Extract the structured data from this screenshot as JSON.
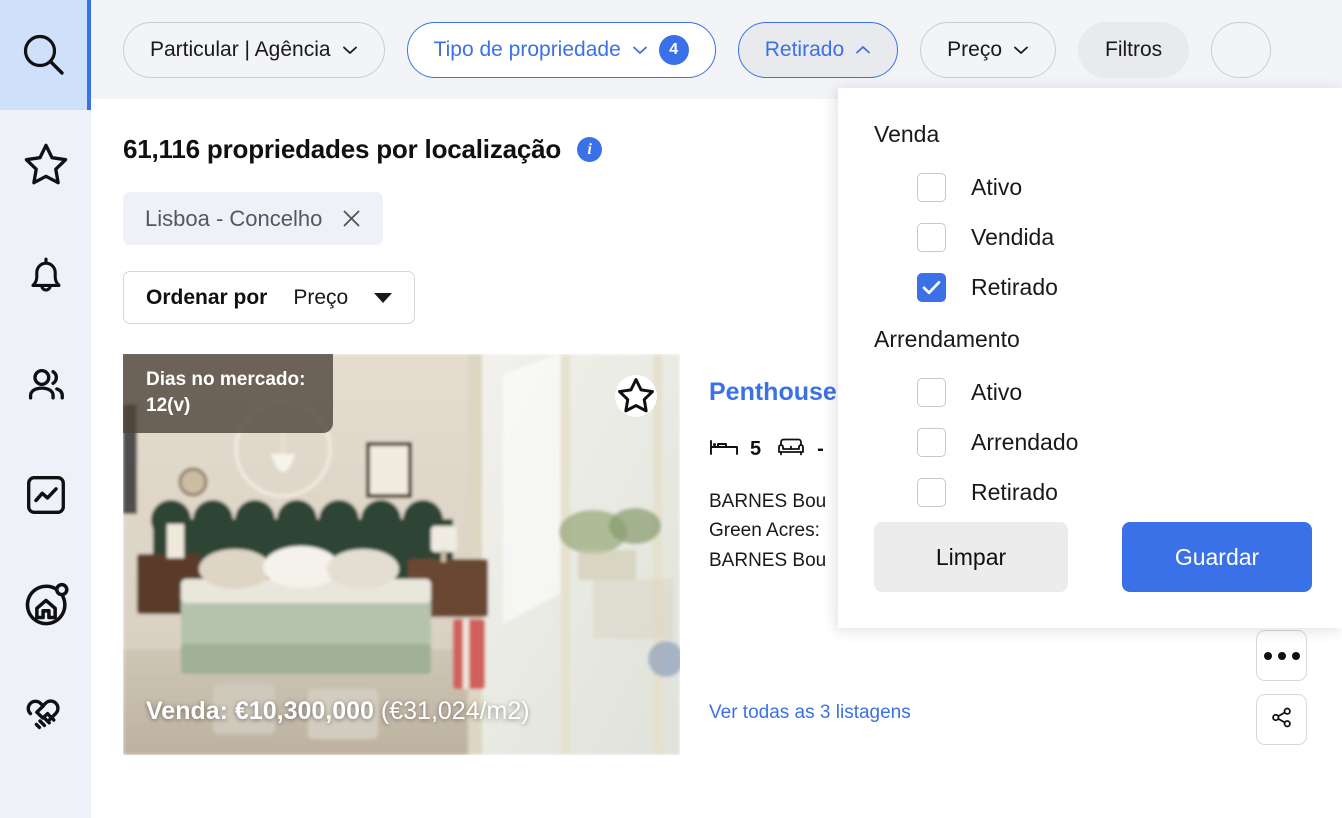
{
  "sidebar": {
    "items": [
      {
        "name": "search",
        "icon": "search-icon",
        "active": true
      },
      {
        "name": "favorites",
        "icon": "star-icon",
        "active": false
      },
      {
        "name": "alerts",
        "icon": "bell-icon",
        "active": false
      },
      {
        "name": "contacts",
        "icon": "people-icon",
        "active": false
      },
      {
        "name": "market-analytics",
        "icon": "chart-icon",
        "active": false
      },
      {
        "name": "valuation",
        "icon": "home-circle-icon",
        "active": false
      },
      {
        "name": "deals",
        "icon": "handshake-icon",
        "active": false
      }
    ]
  },
  "filterbar": {
    "chips": [
      {
        "label": "Particular | Agência",
        "state": "plain",
        "chevron": "down",
        "badge": null
      },
      {
        "label": "Tipo de propriedade",
        "state": "selected",
        "chevron": "down",
        "badge": "4"
      },
      {
        "label": "Retirado",
        "state": "open-active",
        "chevron": "up",
        "badge": null
      },
      {
        "label": "Preço",
        "state": "plain",
        "chevron": "down",
        "badge": null
      },
      {
        "label": "Filtros",
        "state": "nooutline",
        "chevron": null,
        "badge": null
      }
    ]
  },
  "results": {
    "count_text": "61,116 propriedades por localização",
    "info_icon": "info-icon",
    "info_glyph": "i",
    "location_chip": {
      "label": "Lisboa - Concelho",
      "remove_icon": "close-icon"
    },
    "sort": {
      "label": "Ordenar por",
      "value": "Preço",
      "icon": "triangle-down-icon"
    }
  },
  "card": {
    "days_on_market": "Dias no mercado: 12(v)",
    "favorite_icon": "star-icon",
    "price_main": "Venda: €10,300,000",
    "price_per_m2": "(€31,024/m2)",
    "title": "Penthouse",
    "specs": [
      {
        "icon": "bed-icon",
        "value": "5"
      },
      {
        "icon": "sofa-icon",
        "value": "-"
      }
    ],
    "description_lines": [
      "BARNES Bou",
      "Green Acres:",
      "BARNES Bou"
    ],
    "all_listings_link": "Ver todas as 3 listagens",
    "actions": [
      {
        "name": "more-options-button",
        "icon": "more-dots-icon"
      },
      {
        "name": "share-button",
        "icon": "share-icon"
      }
    ]
  },
  "dropdown": {
    "groups": [
      {
        "title": "Venda",
        "options": [
          {
            "label": "Ativo",
            "checked": false
          },
          {
            "label": "Vendida",
            "checked": false
          },
          {
            "label": "Retirado",
            "checked": true
          }
        ]
      },
      {
        "title": "Arrendamento",
        "options": [
          {
            "label": "Ativo",
            "checked": false
          },
          {
            "label": "Arrendado",
            "checked": false
          },
          {
            "label": "Retirado",
            "checked": false
          }
        ]
      }
    ],
    "clear_label": "Limpar",
    "save_label": "Guardar"
  },
  "colors": {
    "accent_blue": "#3b71e8",
    "rail_active_bg": "#cfe0fb",
    "bar_bg": "#f2f4f8",
    "chip_grey": "#e8eaee"
  }
}
